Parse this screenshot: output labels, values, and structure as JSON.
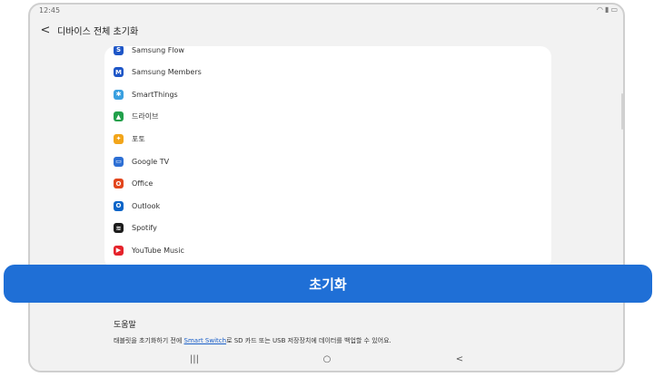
{
  "statusbar": {
    "time": "12:45"
  },
  "header": {
    "title": "디바이스 전체 초기화",
    "back_glyph": "<"
  },
  "apps": [
    {
      "label": "Samsung Flow",
      "icon": "samsung-flow-icon",
      "color": "#1e56c7",
      "glyph": "S"
    },
    {
      "label": "Samsung Members",
      "icon": "samsung-members-icon",
      "color": "#1e56c7",
      "glyph": "M"
    },
    {
      "label": "SmartThings",
      "icon": "smartthings-icon",
      "color": "#3aa0e0",
      "glyph": "✱"
    },
    {
      "label": "드라이브",
      "icon": "google-drive-icon",
      "color": "#22a04b",
      "glyph": "▲"
    },
    {
      "label": "포토",
      "icon": "google-photos-icon",
      "color": "#f2a51a",
      "glyph": "✦"
    },
    {
      "label": "Google TV",
      "icon": "google-tv-icon",
      "color": "#2d6fd4",
      "glyph": "▭"
    },
    {
      "label": "Office",
      "icon": "office-icon",
      "color": "#e2461d",
      "glyph": "O"
    },
    {
      "label": "Outlook",
      "icon": "outlook-icon",
      "color": "#0a64c8",
      "glyph": "O"
    },
    {
      "label": "Spotify",
      "icon": "spotify-icon",
      "color": "#1c1c1c",
      "glyph": "≋"
    },
    {
      "label": "YouTube Music",
      "icon": "youtube-music-icon",
      "color": "#e5232b",
      "glyph": "▶"
    }
  ],
  "reset_button": {
    "label": "초기화"
  },
  "help": {
    "title": "도움말",
    "text_before": "태블릿을 초기화하기 전에 ",
    "link": "Smart Switch",
    "text_after": "로 SD 카드 또는 USB 저장장치에 데이터를 백업할 수 있어요."
  },
  "navbar": {
    "recents": "|||",
    "home": "○",
    "back": "<"
  }
}
